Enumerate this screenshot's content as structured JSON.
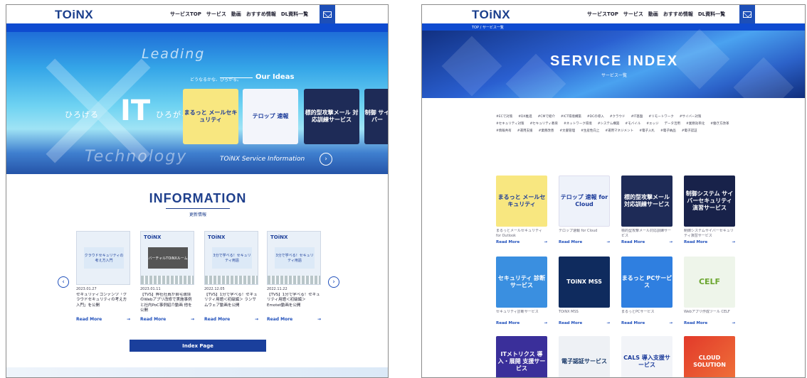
{
  "header": {
    "logo": "TOiNX",
    "nav": [
      "サービスTOP",
      "サービス",
      "動画",
      "おすすめ情報",
      "DL資料一覧"
    ]
  },
  "left_page": {
    "hero": {
      "leading": "Leading",
      "technology": "Technology",
      "it": "IT",
      "hirogeru_left": "ひろげる",
      "hirogeru_right": "ひろがる",
      "tagline": "どうなるかな、ひろがる。",
      "our_ideas": "Our Ideas",
      "service_info": "TOiNX Service Information",
      "cards": [
        "まるっと メールセキュリティ",
        "テロップ 速報",
        "標的型攻撃メール 対応訓練サービス",
        "制御 サイバー"
      ]
    },
    "information": {
      "title": "INFORMATION",
      "subtitle": "更新情報",
      "news": [
        {
          "thumb": "クラウドセキュリティの考え方入門",
          "brand": "",
          "date": "2023.01.27",
          "text": "セキュリティコンテンツ「クラウドセキュリティの考え方入門」を公開",
          "read_more": "Read More"
        },
        {
          "thumb": "バーチャルTOiNXルーム",
          "brand": "TOiNX",
          "date": "2023.01.11",
          "text": "【TVS】弊社社員が自宅環境のWebアプリ改修で実施事例と社内PoC事例紹介動画 他を公開",
          "read_more": "Read More"
        },
        {
          "thumb": "3分で学べる！セキュリティ用語",
          "brand": "TOiNX",
          "date": "2022.12.05",
          "text": "【TVS】1分で学べる！セキュリティ用語＜初級編＞ ランサムウェア動画を公開",
          "read_more": "Read More"
        },
        {
          "thumb": "3分で学べる！セキュリティ用語",
          "brand": "TOiNX",
          "date": "2022.11.22",
          "text": "【TVS】1分で学べる！セキュリティ用語＜初級編＞ Emotet動画を公開",
          "read_more": "Read More"
        }
      ],
      "index_button": "Index Page"
    }
  },
  "right_page": {
    "breadcrumb": "TOP / サービス一覧",
    "title": "SERVICE INDEX",
    "title_jp": "サービス一覧",
    "tags": [
      "#ECで対策",
      "#DX推進",
      "#CMで紹介",
      "#ICT環境構築",
      "#DCの導入",
      "#クラウド",
      "#IT基盤",
      "#リモートワーク",
      "#サイバー対策",
      "#セキュリティ対策",
      "#セキュリティ教育",
      "#ネットワーク環境",
      "#システム構築",
      "#モバイル",
      "#エッジ",
      "データ活用",
      "#業務効率化",
      "#働き方改革",
      "#情報共有",
      "#運用支援",
      "#業務改善",
      "#文書管理",
      "#生産性向上",
      "#運用マネジメント",
      "#電子入札",
      "#電子納品",
      "#電子認証"
    ],
    "services": [
      {
        "label": "まるっと メールセキュリティ",
        "name": "まるっとメールセキュリティ for Outlook",
        "read_more": "Read More"
      },
      {
        "label": "テロップ 速報 for Cloud",
        "name": "テロップ速報 for Cloud",
        "read_more": "Read More"
      },
      {
        "label": "標的型攻撃メール 対応訓練サービス",
        "name": "標的型攻撃メール対応訓練サービス",
        "read_more": "Read More"
      },
      {
        "label": "制御システム サイバーセキュリティ 演習サービス",
        "name": "制御システムサイバーセキュリティ演習サービス",
        "read_more": "Read More"
      },
      {
        "label": "セキュリティ 診断サービス",
        "name": "セキュリティ診断サービス",
        "read_more": "Read More"
      },
      {
        "label": "TOiNX MSS",
        "name": "TOiNX MSS",
        "read_more": "Read More"
      },
      {
        "label": "まるっと PCサービス",
        "name": "まるっとPCサービス",
        "read_more": "Read More"
      },
      {
        "label": "CELF",
        "name": "Webアプリ作成ツール CELF",
        "read_more": "Read More"
      },
      {
        "label": "ITメトリクス 導入・展開 支援サービス",
        "name": "",
        "read_more": ""
      },
      {
        "label": "電子認証サービス",
        "name": "",
        "read_more": ""
      },
      {
        "label": "CALS 導入支援サービス",
        "name": "",
        "read_more": ""
      },
      {
        "label": "CLOUD SOLUTION",
        "name": "",
        "read_more": ""
      }
    ]
  }
}
